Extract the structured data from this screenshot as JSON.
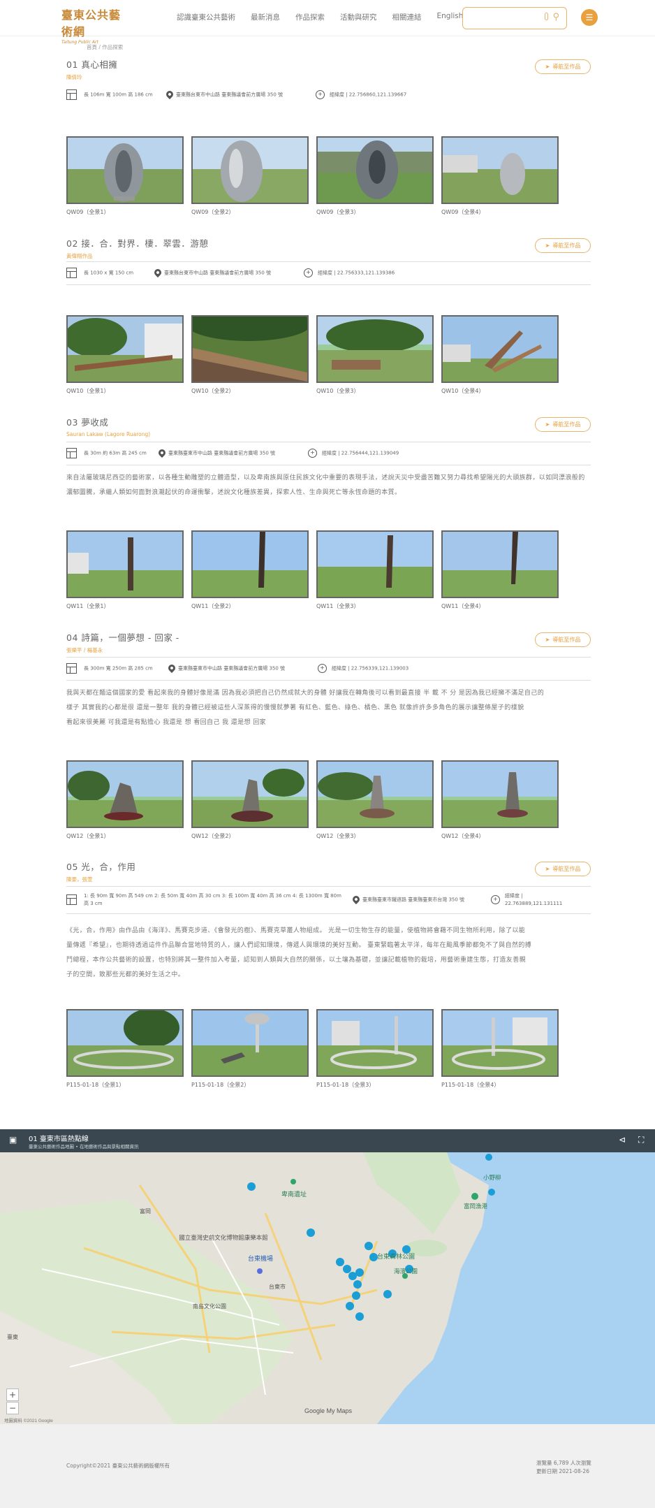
{
  "header": {
    "logo_title": "臺東公共藝術網",
    "logo_sub": "Taitung Public Art",
    "nav": [
      "認識臺東公共藝術",
      "最新消息",
      "作品探索",
      "活動與研究",
      "相關連結",
      "English"
    ],
    "search_placeholder": ""
  },
  "breadcrumb": "首頁 / 作品探索",
  "location_label": "導航至作品",
  "artworks": [
    {
      "title": "01 真心相擁",
      "author": "陳倩玲",
      "info": [
        {
          "icon": "size",
          "text": "長 106m 寬 100m 高 186 cm"
        },
        {
          "icon": "pin",
          "text": "臺東縣台東市中山路 臺東縣議會前方廣場 350 號"
        },
        {
          "icon": "gps",
          "text": "經緯度 | 22.756860,121.139667"
        }
      ],
      "desc": [],
      "photos": [
        "QW09（全景1）",
        "QW09（全景2）",
        "QW09（全景3）",
        "QW09（全景4）"
      ]
    },
    {
      "title": "02 接．合．對界．棲．翠雲．游憩",
      "author": "黃偉翔作品",
      "info": [
        {
          "icon": "size",
          "text": "長 1030 x 寬 150 cm"
        },
        {
          "icon": "pin",
          "text": "臺東縣台東市中山路 臺東縣議會前方廣場 350 號"
        },
        {
          "icon": "gps",
          "text": "經緯度 | 22.756333,121.139386"
        }
      ],
      "desc": [],
      "photos": [
        "QW10（全景1）",
        "QW10（全景2）",
        "QW10（全景3）",
        "QW10（全景4）"
      ]
    },
    {
      "title": "03 夢收成",
      "author": "Sauran Lakaw (Lagore Ruarong)",
      "info": [
        {
          "icon": "size",
          "text": "長 30m 約 63m 高 245 cm"
        },
        {
          "icon": "pin",
          "text": "臺東縣臺東市中山路 臺東縣議會前方廣場 350 號"
        },
        {
          "icon": "gps",
          "text": "經緯度 | 22.756444,121.139049"
        }
      ],
      "desc": [
        "來自法屬玻璃尼西亞的藝術家，以各種生動雕塑的立體造型，以及卑南族與原住民族文化中重要的表現手法，述說天災中受盡苦難又努力尋找希望陽光的大頭族群，以如同漂浪般的濃郁圖騰，承繼人類如何面對浪潮起伏的命運衝擊，述說文化種族差異，探索人性、生命與死亡等永恆命題的本質。"
      ],
      "photos": [
        "QW11（全景1）",
        "QW11（全景2）",
        "QW11（全景3）",
        "QW11（全景4）"
      ]
    },
    {
      "title": "04 詩篇，一個夢想 - 回家 -",
      "author": "張樂平 / 楊基永",
      "info": [
        {
          "icon": "size",
          "text": "長 300m 寬 250m 高 285 cm"
        },
        {
          "icon": "pin",
          "text": "臺東縣臺東市中山路 臺東縣議會前方廣場 350 號"
        },
        {
          "icon": "gps",
          "text": "經緯度 | 22.756339,121.139003"
        }
      ],
      "desc": [
        "我與天都在麵這個國家的愛 看起來我的身體好像是滿 因為我必須把自己仍然成就大的身體 好讓我在轉角後可以看到最直接 半 載 不 分 是因為我已經擁不滿足自己的",
        "樣子 其實我的心都是很 還是一整年 我的身體已經被這些人深蒸得的慢慢就夢著 有紅色、藍色、綠色、橘色、黑色 就像許許多多角色的展示讓整條屋子的樣貌",
        "看起來很美麗 可我還是有點擔心 我還是 想 看回自己 我 還是想 回家"
      ],
      "photos": [
        "QW12（全景1）",
        "QW12（全景2）",
        "QW12（全景3）",
        "QW12（全景4）"
      ]
    },
    {
      "title": "05 光，合，作用",
      "author": "陳豪，張萱",
      "info": [
        {
          "icon": "size",
          "text": "1: 長 90m 寬 90m 高 549 cm 2: 長 50m 寬 40m 高 30 cm 3: 長 100m 寬 40m 高 36 cm 4: 長 1300m 寬 80m 高 3 cm"
        },
        {
          "icon": "pin",
          "text": "臺東縣臺東市鐵道路 臺東縣臺東市台灣 350 號"
        },
        {
          "icon": "gps",
          "text": "經緯度 | 22.763889,121.131111"
        }
      ],
      "desc": [
        "《光，合，作用》由作品由《海洋》、馬賽克步道、《會發光的樹》、馬賽克草叢人物組成。 光是一切生物生存的能量，使植物將會藉不同生物所利用，除了以能",
        "量傳遞『希望』，也期待透過這件作品聯合當地特質的人，讓人們認知環境，傳遞人與環境的美好互動。 臺東緊臨著太平洋，每年在颱風季節都免不了與自然的搏",
        "鬥總程，本作公共藝術的設置，也特別將其一整件加入考量，認知到人類與大自然的關係，以土壤為基礎，並讓記載植物的栽培，用藝術重建生態，打造友善親",
        "子的空間，致那些光都的美好生活之中。"
      ],
      "photos": [
        "P115-01-18（全景1）",
        "P115-01-18（全景2）",
        "P115-01-18（全景3）",
        "P115-01-18（全景4）"
      ]
    }
  ],
  "map": {
    "title": "01 臺東市區熱點線",
    "subtitle": "臺東公共藝術作品地圖 • 在地藝術作品與景點相關資訊",
    "places": [
      "台東市",
      "南島文化公園",
      "國立臺灣史前文化博物館康樂本館",
      "台東森林公園",
      "海濱公園",
      "小野柳",
      "富岡漁港",
      "卑南遺址",
      "富岡",
      "台東機場",
      "臺東"
    ],
    "attribution": "地圖資料 ©2021 Google",
    "brand": "Google My Maps"
  },
  "footer": {
    "copyright": "Copyright©2021 臺東公共藝術網版權所有",
    "visits": "瀏覽量 6,789 人次瀏覽",
    "updated": "更新日期 2021-08-26"
  }
}
